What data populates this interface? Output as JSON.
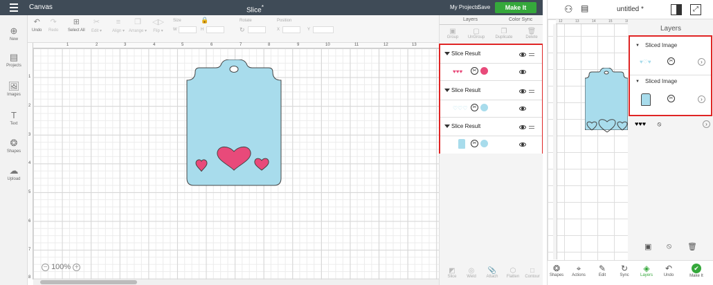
{
  "desktop": {
    "app_title": "Canvas",
    "doc_title": "Slice",
    "doc_modified_mark": "*",
    "my_projects": "My Projects",
    "save": "Save",
    "make_it": "Make It",
    "toolbar": {
      "undo": "Undo",
      "redo": "Redo",
      "select_all": "Select All",
      "edit": "Edit ▾",
      "align": "Align ▾",
      "arrange": "Arrange ▾",
      "flip": "Flip ▾",
      "size": "Size",
      "w": "W",
      "h": "H",
      "rotate": "Rotate",
      "position": "Position",
      "x": "X",
      "y": "Y"
    },
    "sidebar": [
      "New",
      "Projects",
      "Images",
      "Text",
      "Shapes",
      "Upload"
    ],
    "ruler_top": [
      "1",
      "2",
      "3",
      "4",
      "5",
      "6",
      "7",
      "8",
      "9",
      "10",
      "11",
      "12",
      "13"
    ],
    "ruler_left": [
      "1",
      "2",
      "3",
      "4",
      "5",
      "6",
      "7",
      "8"
    ],
    "zoom": "100%",
    "panel": {
      "tabs": [
        "Layers",
        "Color Sync"
      ],
      "actions": [
        "Group",
        "UnGroup",
        "Duplicate",
        "Delete"
      ],
      "bottom": [
        "Slice",
        "Weld",
        "Attach",
        "Flatten",
        "Contour"
      ],
      "layers": [
        {
          "name": "Slice Result",
          "color": "#e84a7a"
        },
        {
          "name": "Slice Result",
          "color": "#a8dcec"
        },
        {
          "name": "Slice Result",
          "color": "#a8dcec"
        }
      ]
    },
    "tag_color": "#a8dcec",
    "heart_color": "#e84a7a"
  },
  "mobile": {
    "title": "untitled *",
    "ruler": [
      "12",
      "13",
      "14",
      "15",
      "16"
    ],
    "layers_title": "Layers",
    "layers": [
      "Sliced Image",
      "Sliced Image"
    ],
    "bottom": [
      "Shapes",
      "Actions",
      "Edit",
      "Sync",
      "Layers",
      "Undo",
      "Make It"
    ],
    "active": "Layers"
  }
}
